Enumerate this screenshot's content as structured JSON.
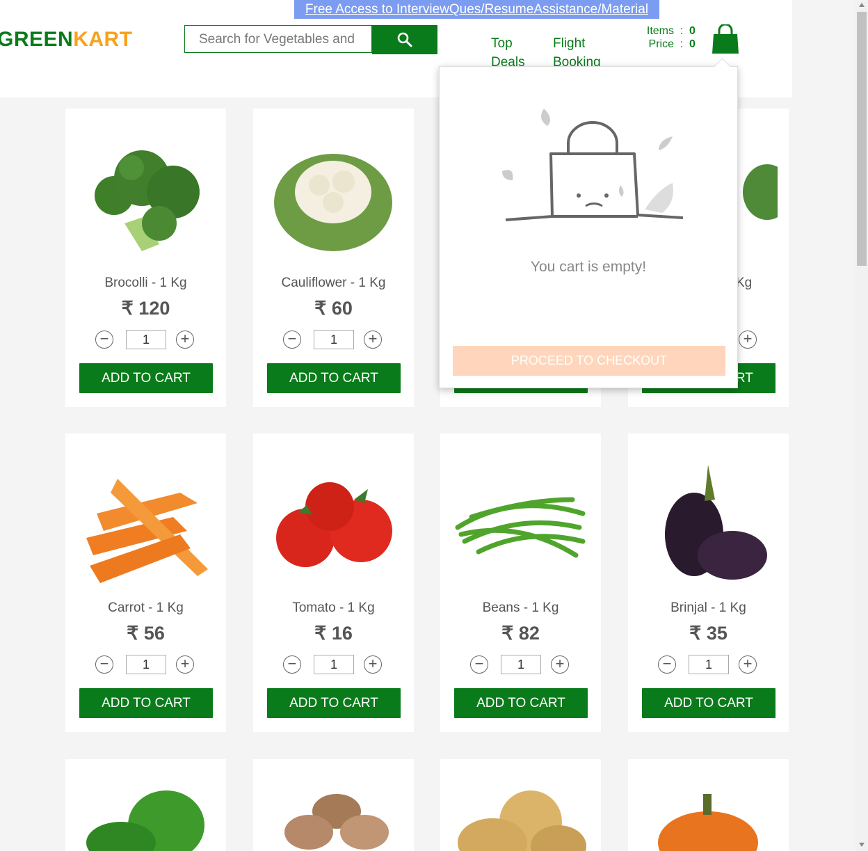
{
  "promo_link": "Free Access to InterviewQues/ResumeAssistance/Material",
  "logo": {
    "green": "GREEN",
    "kart": "KART"
  },
  "search": {
    "placeholder": "Search for Vegetables and"
  },
  "nav": [
    {
      "line1": "Top",
      "line2": "Deals"
    },
    {
      "line1": "Flight",
      "line2": "Booking"
    }
  ],
  "cart_summary": {
    "items_label": "Items",
    "items_value": "0",
    "price_label": "Price",
    "price_value": "0",
    "separator": ":"
  },
  "cart_popup": {
    "empty_text": "You cart is empty!",
    "checkout_label": "PROCEED TO CHECKOUT"
  },
  "add_to_cart_label": "ADD TO CART",
  "products": [
    {
      "name": "Brocolli - 1 Kg",
      "price": "₹ 120",
      "qty": "1"
    },
    {
      "name": "Cauliflower - 1 Kg",
      "price": "₹ 60",
      "qty": "1"
    },
    {
      "name": "",
      "price": "",
      "qty": ""
    },
    {
      "name": "Kg",
      "price": "",
      "qty": ""
    },
    {
      "name": "Carrot - 1 Kg",
      "price": "₹ 56",
      "qty": "1"
    },
    {
      "name": "Tomato - 1 Kg",
      "price": "₹ 16",
      "qty": "1"
    },
    {
      "name": "Beans - 1 Kg",
      "price": "₹ 82",
      "qty": "1"
    },
    {
      "name": "Brinjal - 1 Kg",
      "price": "₹ 35",
      "qty": "1"
    }
  ],
  "colors": {
    "brand_green": "#0a7b1a",
    "brand_orange": "#f7a21b",
    "promo_bg": "#7b9cf0",
    "checkout_disabled": "#ffd6bb"
  }
}
